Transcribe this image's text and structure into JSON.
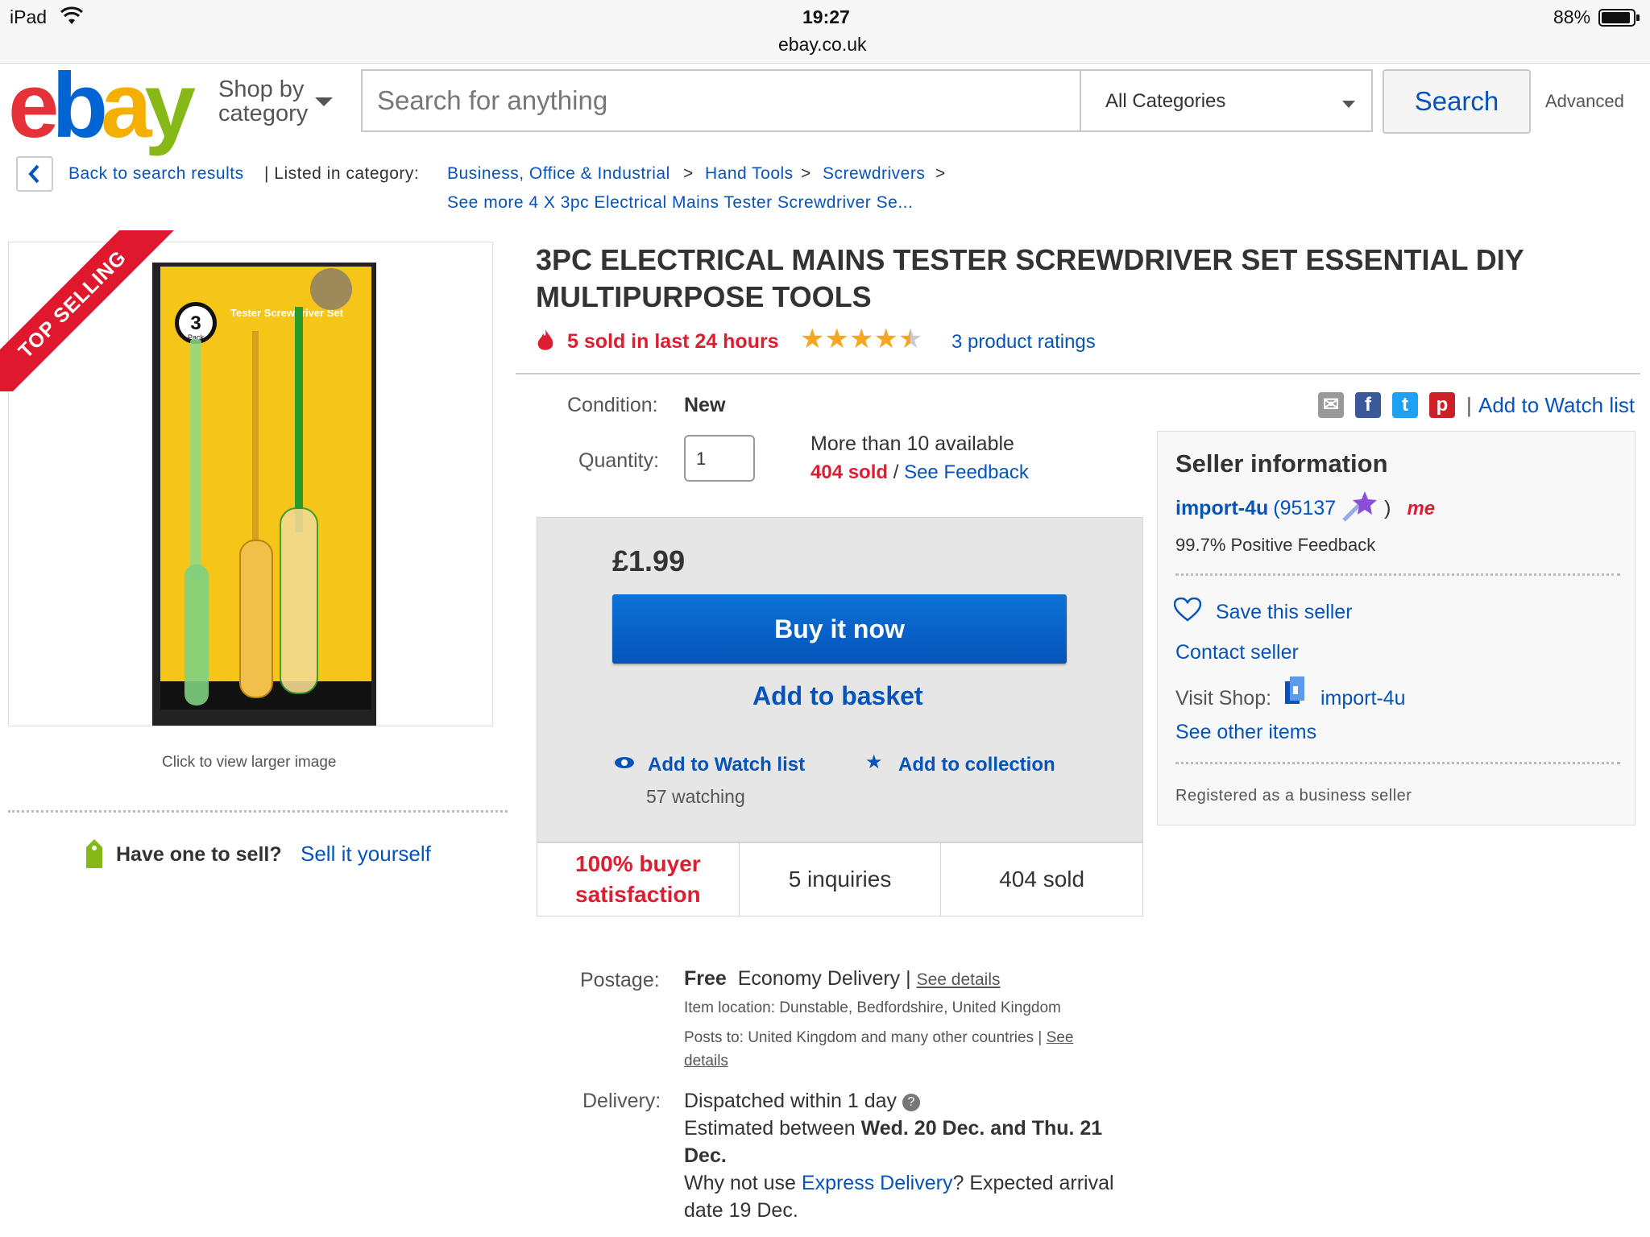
{
  "status_bar": {
    "device": "iPad",
    "time": "19:27",
    "battery": "88%",
    "url": "ebay.co.uk"
  },
  "header": {
    "logo": "ebay",
    "shop_by_line1": "Shop by",
    "shop_by_line2": "category",
    "search_placeholder": "Search for anything",
    "category_selected": "All Categories",
    "search_button": "Search",
    "advanced": "Advanced"
  },
  "breadcrumb": {
    "back": "Back to search results",
    "listed_in": "| Listed in category:",
    "items": [
      "Business, Office & Industrial",
      "Hand Tools",
      "Screwdrivers"
    ],
    "sep": ">",
    "see_more": "See more 4 X 3pc Electrical Mains Tester Screwdriver Se..."
  },
  "gallery": {
    "badge": "TOP SELLING",
    "pack_label": "3",
    "pack_sub": "Pack",
    "product_text": "Tester Screwdriver Set",
    "caption": "Click to view larger image"
  },
  "sell": {
    "question": "Have one to sell?",
    "link": "Sell it yourself"
  },
  "product": {
    "title_line1": "3PC ELECTRICAL MAINS TESTER SCREWDRIVER SET ESSENTIAL DIY",
    "title_line2": "MULTIPURPOSE TOOLS",
    "sold_recent": "5 sold in last 24 hours",
    "rating_value": 4.5,
    "ratings_link": "3 product ratings",
    "condition_label": "Condition:",
    "condition_value": "New",
    "quantity_label": "Quantity:",
    "quantity_value": "1",
    "available": "More than 10 available",
    "sold_count": "404 sold",
    "slash": " / ",
    "see_feedback": "See Feedback",
    "watch_list_top": "Add to Watch list",
    "price": "£1.99",
    "buy_now": "Buy it now",
    "add_basket": "Add to basket",
    "add_watch": "Add to Watch list",
    "watching": "57 watching",
    "add_collection": "Add to collection",
    "stat_satisfaction_1": "100% buyer",
    "stat_satisfaction_2": "satisfaction",
    "stat_inquiries": "5 inquiries",
    "stat_sold": "404 sold"
  },
  "shipping": {
    "postage_label": "Postage:",
    "postage_free": "Free",
    "postage_type": "Economy Delivery |",
    "see_details": "See details",
    "location": "Item location:  Dunstable, Bedfordshire, United Kingdom",
    "posts_to": "Posts to:  United Kingdom and many other countries |",
    "see": "See",
    "details": "details",
    "delivery_label": "Delivery:",
    "dispatched": "Dispatched within 1 day",
    "estimated_prefix": "Estimated between",
    "estimated_dates_1": "Wed. 20 Dec. and Thu. 21",
    "estimated_dates_2": "Dec.",
    "why_prefix": "Why not use",
    "express": "Express Delivery",
    "why_suffix": "? Expected arrival",
    "arrival": "date 19 Dec."
  },
  "seller": {
    "heading": "Seller information",
    "name": "import-4u",
    "score": "(95137",
    "score_close": ")",
    "me_badge": "me",
    "feedback": "99.7% Positive Feedback",
    "save": "Save this seller",
    "contact": "Contact seller",
    "visit_label": "Visit Shop:",
    "shop_name": "import-4u",
    "other_items": "See other items",
    "registered": "Registered as a business seller"
  },
  "colors": {
    "link": "#0654ba",
    "red": "#dd1e31",
    "star": "#f5a623",
    "buy_button": "#0654ba"
  }
}
